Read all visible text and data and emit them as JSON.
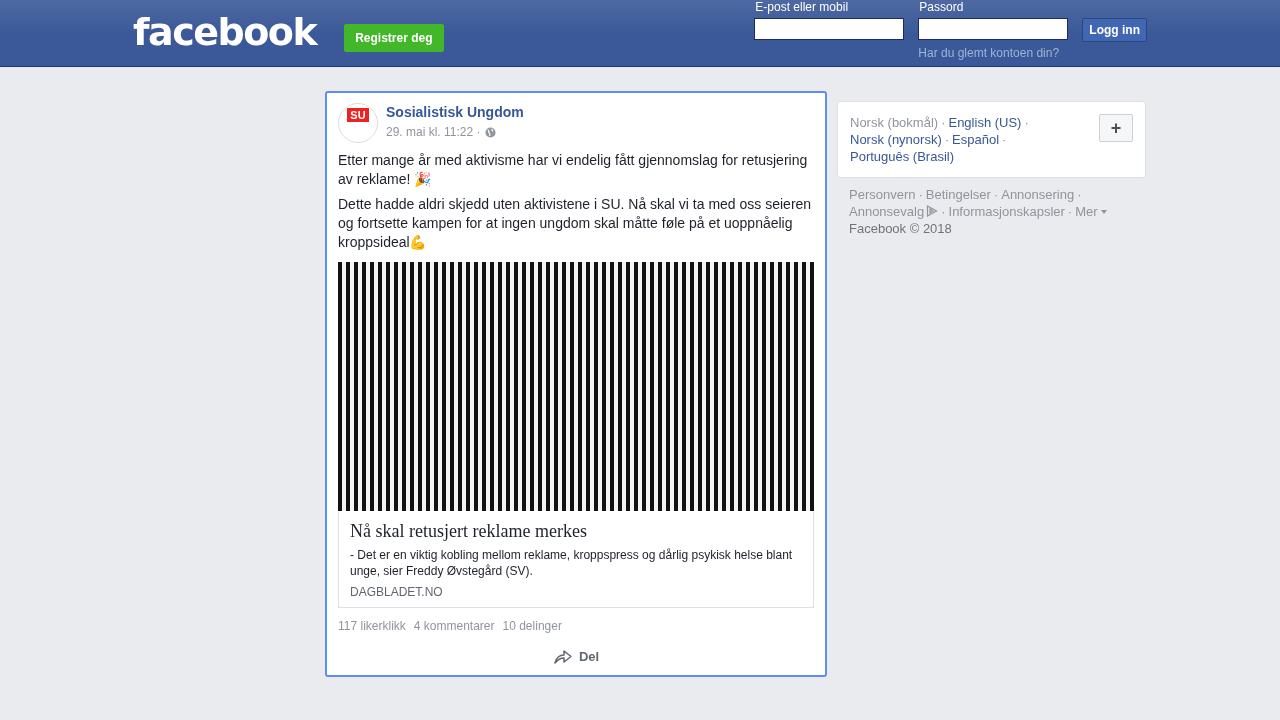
{
  "header": {
    "logo": "facebook",
    "register_button": "Registrer deg",
    "email_label": "E-post eller mobil",
    "password_label": "Passord",
    "login_button": "Logg inn",
    "forgot_link": "Har du glemt kontoen din?"
  },
  "post": {
    "author": "Sosialistisk Ungdom",
    "avatar_text": "SU",
    "timestamp": "29. mai kl. 11:22 ·",
    "paragraphs": [
      "Etter mange år med aktivisme har vi endelig fått gjennomslag for retusjering av reklame! 🎉",
      "Dette hadde aldri skjedd uten aktivistene i SU. Nå skal vi ta med oss seieren og fortsette kampen for at ingen ungdom skal måtte føle på et uoppnåelig kroppsideal💪"
    ],
    "link": {
      "title": "Nå skal retusjert reklame merkes",
      "description": "- Det er en viktig kobling mellom reklame, kroppspress og dårlig psykisk helse blant unge, sier Freddy Øvstegård (SV).",
      "domain": "DAGBLADET.NO"
    },
    "stats": [
      "117 likerklikk",
      "4 kommentarer",
      "10 delinger"
    ],
    "share_button": "Del"
  },
  "languages": [
    {
      "label": "Norsk (bokmål)",
      "selected": true
    },
    {
      "label": "English (US)",
      "selected": false
    },
    {
      "label": "Norsk (nynorsk)",
      "selected": false
    },
    {
      "label": "Español",
      "selected": false
    },
    {
      "label": "Português (Brasil)",
      "selected": false
    }
  ],
  "separator": "·",
  "add_language_button": "+",
  "footer_links": [
    {
      "label": "Personvern",
      "kind": "plain"
    },
    {
      "label": "Betingelser",
      "kind": "plain"
    },
    {
      "label": "Annonsering",
      "kind": "plain"
    },
    {
      "label": "Annonsevalg",
      "kind": "adchoices"
    },
    {
      "label": "Informasjonskapsler",
      "kind": "plain"
    },
    {
      "label": "Mer",
      "kind": "menu"
    }
  ],
  "copyright": "Facebook © 2018"
}
